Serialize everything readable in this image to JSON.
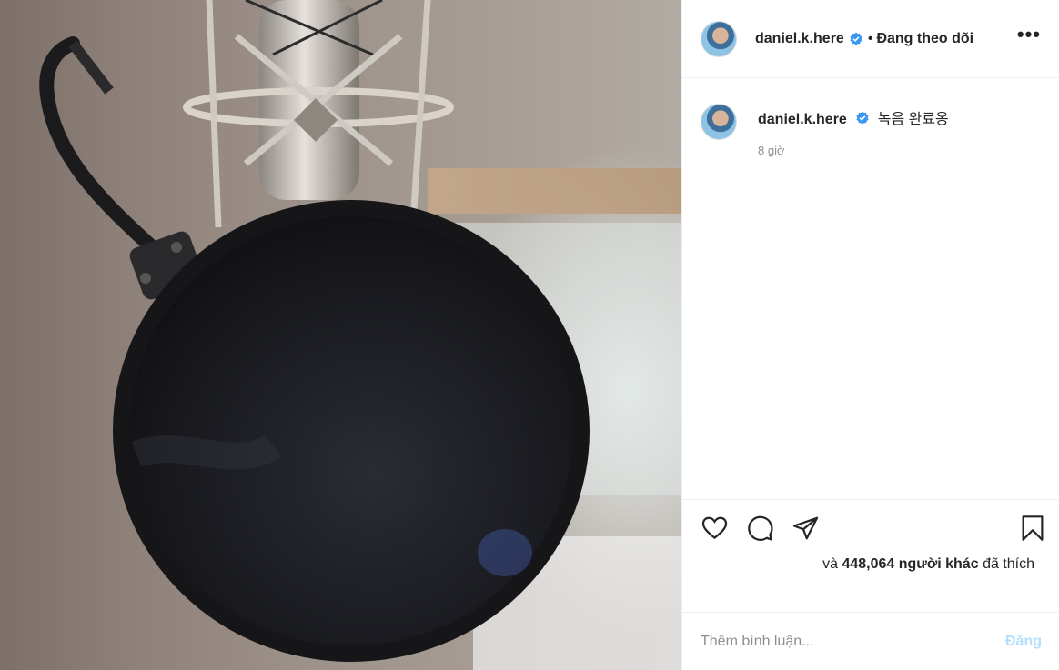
{
  "photo": {
    "description_icon": "microphone-pop-filter-photo"
  },
  "header": {
    "username": "daniel.k.here",
    "separator": "•",
    "follow_status": "Đang theo dõi",
    "more_label": "•••"
  },
  "caption": {
    "username": "daniel.k.here",
    "text": "녹음 완료옹",
    "time": "8 giờ"
  },
  "actions": {
    "icons": [
      "heart-icon",
      "comment-icon",
      "share-icon",
      "bookmark-icon"
    ]
  },
  "likes": {
    "prefix": "và",
    "count": "448,064",
    "others": "người khác",
    "suffix": "đã thích"
  },
  "comment": {
    "placeholder": "Thêm bình luận...",
    "post_label": "Đăng"
  },
  "colors": {
    "verified": "#3897f0",
    "post_disabled": "#b2dffc",
    "secondary_text": "#8e8e8e"
  }
}
